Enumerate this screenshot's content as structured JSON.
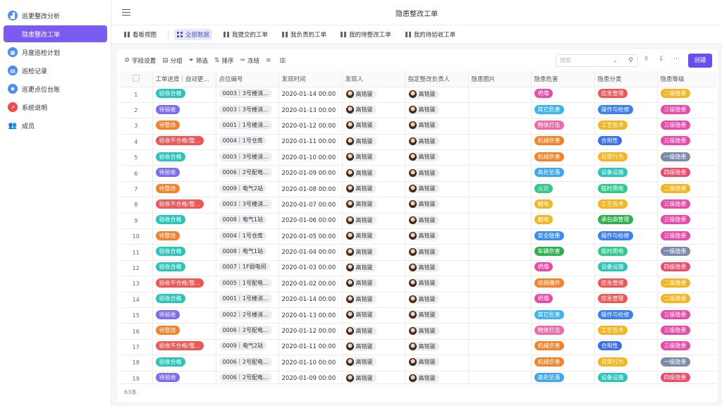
{
  "sidebar": {
    "items": [
      {
        "label": "巡更整改分析",
        "icon": "chart-icon",
        "color": "#4b8df8"
      },
      {
        "label": "隐患整改工单",
        "icon": "question-icon",
        "color": "#7b5cf0"
      },
      {
        "label": "月度巡检计划",
        "icon": "calendar-icon",
        "color": "#4b8df8"
      },
      {
        "label": "巡检记录",
        "icon": "clipboard-icon",
        "color": "#4b8df8"
      },
      {
        "label": "巡更点位台账",
        "icon": "gear-icon",
        "color": "#4b8df8"
      },
      {
        "label": "系统说明",
        "icon": "trend-icon",
        "color": "#f04a4a"
      },
      {
        "label": "成员",
        "icon": "users-icon",
        "color": "#888888"
      }
    ],
    "active": 1
  },
  "header": {
    "title": "隐患整改工单"
  },
  "view_tabs": [
    {
      "label": "看板视图",
      "active": false
    },
    {
      "label": "全部数据",
      "active": true
    },
    {
      "label": "我提交的工单",
      "active": false
    },
    {
      "label": "我负责的工单",
      "active": false
    },
    {
      "label": "我的待整改工单",
      "active": false
    },
    {
      "label": "我的待验收工单",
      "active": false
    }
  ],
  "toolbar": {
    "field_settings": "字段设置",
    "group": "分组",
    "filter": "筛选",
    "sort": "排序",
    "freeze": "冻结",
    "search_placeholder": "搜索",
    "create": "创建"
  },
  "columns": [
    "工单进度｜自动更...",
    "点位编号",
    "发现时间",
    "发现人",
    "指定整改负责人",
    "隐患图片",
    "隐患危害",
    "隐患分类",
    "隐患等级"
  ],
  "colors": {
    "验收合格": "#2bc4b8",
    "待验收": "#7b6cf0",
    "待整改": "#f5822a",
    "验收不合格/整...": "#ef5757",
    "坍塌": "#e94aa8",
    "其它危害": "#3fb2f0",
    "物体打击": "#f06aa8",
    "机械伤害": "#f5822a",
    "高处坠落": "#3fa5f0",
    "火灾": "#2fc98a",
    "触电": "#f5b520",
    "安全隐患": "#3a8ef0",
    "车辆伤害": "#2fb050",
    "容器爆炸": "#f5822a",
    "应急管理": "#ef5757",
    "操作与检修": "#3a7ef0",
    "工艺技术": "#f5b520",
    "合规性": "#3a6ef0",
    "日常行为": "#f5b520",
    "设备设施": "#2bc4b8",
    "临时用电": "#2fc98a",
    "承包商管理": "#2fb050",
    "二级隐患": "#f5b520",
    "三级隐患": "#e94aa8",
    "一级隐患": "#7b8aa8",
    "四级隐患": "#ef4a6a"
  },
  "rows": [
    {
      "n": "1",
      "status": "验收合格",
      "loc": "0003｜3号楼消...",
      "time": "2020-01-14 00:00",
      "finder": "高铭骏",
      "owner": "高铭骏",
      "hazard": "坍塌",
      "cat": "应急管理",
      "level": "二级隐患"
    },
    {
      "n": "2",
      "status": "待验收",
      "loc": "0003｜3号楼消...",
      "time": "2020-01-13 00:00",
      "finder": "高铭骏",
      "owner": "高铭骏",
      "hazard": "其它危害",
      "cat": "操作与检修",
      "level": "三级隐患"
    },
    {
      "n": "3",
      "status": "待整改",
      "loc": "0001｜1号楼消...",
      "time": "2020-01-12 00:00",
      "finder": "高铭骏",
      "owner": "高铭骏",
      "hazard": "物体打击",
      "cat": "工艺技术",
      "level": "三级隐患"
    },
    {
      "n": "4",
      "status": "验收不合格/整...",
      "loc": "0004｜1号仓库",
      "time": "2020-01-11 00:00",
      "finder": "高铭骏",
      "owner": "高铭骏",
      "hazard": "机械伤害",
      "cat": "合规性",
      "level": "三级隐患"
    },
    {
      "n": "5",
      "status": "验收合格",
      "loc": "0003｜3号楼消...",
      "time": "2020-01-10 00:00",
      "finder": "高铭骏",
      "owner": "高铭骏",
      "hazard": "机械伤害",
      "cat": "日常行为",
      "level": "一级隐患"
    },
    {
      "n": "6",
      "status": "待验收",
      "loc": "0006｜2号配电...",
      "time": "2020-01-09 00:00",
      "finder": "高铭骏",
      "owner": "高铭骏",
      "hazard": "高处坠落",
      "cat": "设备设施",
      "level": "四级隐患"
    },
    {
      "n": "7",
      "status": "待整改",
      "loc": "0009｜电气2站",
      "time": "2020-01-08 00:00",
      "finder": "高铭骏",
      "owner": "高铭骏",
      "hazard": "火灾",
      "cat": "临时用电",
      "level": "二级隐患"
    },
    {
      "n": "8",
      "status": "验收不合格/整...",
      "loc": "0003｜3号楼消...",
      "time": "2020-01-07 00:00",
      "finder": "高铭骏",
      "owner": "高铭骏",
      "hazard": "触电",
      "cat": "工艺技术",
      "level": "三级隐患"
    },
    {
      "n": "9",
      "status": "验收合格",
      "loc": "0008｜电气1站",
      "time": "2020-01-06 00:00",
      "finder": "高铭骏",
      "owner": "高铭骏",
      "hazard": "触电",
      "cat": "承包商管理",
      "level": "三级隐患"
    },
    {
      "n": "10",
      "status": "待整改",
      "loc": "0004｜1号仓库",
      "time": "2020-01-05 00:00",
      "finder": "高铭骏",
      "owner": "高铭骏",
      "hazard": "安全隐患",
      "cat": "操作与检修",
      "level": "三级隐患"
    },
    {
      "n": "11",
      "status": "验收合格",
      "loc": "0008｜电气1站",
      "time": "2020-01-04 00:00",
      "finder": "高铭骏",
      "owner": "高铭骏",
      "hazard": "车辆伤害",
      "cat": "临时用电",
      "level": "一级隐患"
    },
    {
      "n": "12",
      "status": "验收合格",
      "loc": "0007｜1F弱电间",
      "time": "2020-01-03 00:00",
      "finder": "高铭骏",
      "owner": "高铭骏",
      "hazard": "坍塌",
      "cat": "设备设施",
      "level": "四级隐患"
    },
    {
      "n": "13",
      "status": "验收不合格/整...",
      "loc": "0005｜1号配电...",
      "time": "2020-01-02 00:00",
      "finder": "高铭骏",
      "owner": "高铭骏",
      "hazard": "容器爆炸",
      "cat": "应急管理",
      "level": "二级隐患"
    },
    {
      "n": "14",
      "status": "验收合格",
      "loc": "0001｜1号楼消...",
      "time": "2020-01-14 00:00",
      "finder": "高铭骏",
      "owner": "高铭骏",
      "hazard": "坍塌",
      "cat": "应急管理",
      "level": "二级隐患"
    },
    {
      "n": "15",
      "status": "待验收",
      "loc": "0002｜2号楼消...",
      "time": "2020-01-13 00:00",
      "finder": "高铭骏",
      "owner": "高铭骏",
      "hazard": "其它危害",
      "cat": "操作与检修",
      "level": "三级隐患"
    },
    {
      "n": "16",
      "status": "待整改",
      "loc": "0006｜2号配电...",
      "time": "2020-01-12 00:00",
      "finder": "高铭骏",
      "owner": "高铭骏",
      "hazard": "物体打击",
      "cat": "工艺技术",
      "level": "三级隐患"
    },
    {
      "n": "17",
      "status": "验收不合格/整...",
      "loc": "0009｜电气2站",
      "time": "2020-01-11 00:00",
      "finder": "高铭骏",
      "owner": "高铭骏",
      "hazard": "机械伤害",
      "cat": "合规性",
      "level": "三级隐患"
    },
    {
      "n": "18",
      "status": "验收合格",
      "loc": "0006｜2号配电...",
      "time": "2020-01-10 00:00",
      "finder": "高铭骏",
      "owner": "高铭骏",
      "hazard": "机械伤害",
      "cat": "日常行为",
      "level": "一级隐患"
    },
    {
      "n": "19",
      "status": "待验收",
      "loc": "0006｜2号配电...",
      "time": "2020-01-09 00:00",
      "finder": "高铭骏",
      "owner": "高铭骏",
      "hazard": "高处坠落",
      "cat": "设备设施",
      "level": "四级隐患"
    }
  ],
  "footer": {
    "count": "63条"
  }
}
